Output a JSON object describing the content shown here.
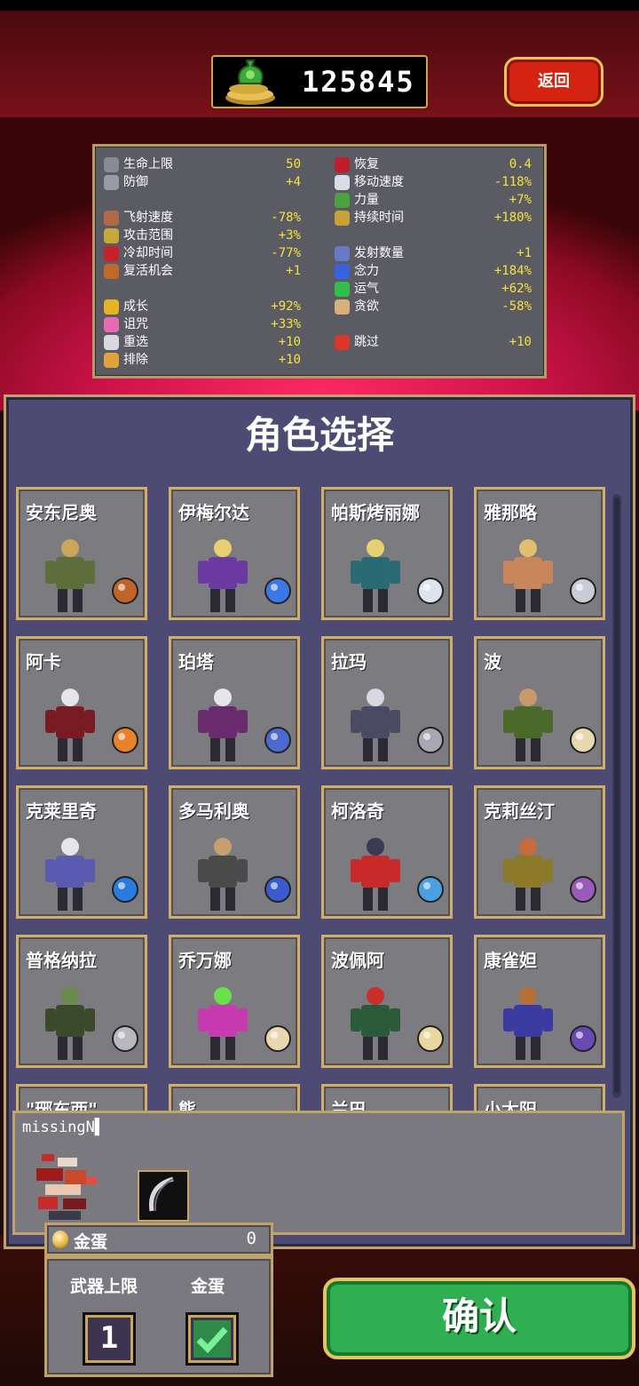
{
  "header": {
    "coins": "125845",
    "back_label": "返回"
  },
  "stats": {
    "left": [
      {
        "name": "生命上限",
        "value": "50",
        "icon": "heart-max-icon",
        "color": "#8a8a92"
      },
      {
        "name": "防御",
        "value": "+4",
        "icon": "armor-icon",
        "color": "#9a9aa6"
      },
      {
        "name": "飞射速度",
        "value": "-78%",
        "icon": "speed-arrow-icon",
        "color": "#b06a48"
      },
      {
        "name": "攻击范围",
        "value": "+3%",
        "icon": "area-icon",
        "color": "#c6a838"
      },
      {
        "name": "冷却时间",
        "value": "-77%",
        "icon": "cooldown-icon",
        "color": "#c8202a"
      },
      {
        "name": "复活机会",
        "value": "+1",
        "icon": "revival-icon",
        "color": "#c06a2a"
      },
      {
        "name": "成长",
        "value": "+92%",
        "icon": "growth-icon",
        "color": "#e6b422"
      },
      {
        "name": "诅咒",
        "value": "+33%",
        "icon": "curse-icon",
        "color": "#e86ab4"
      },
      {
        "name": "重选",
        "value": "+10",
        "icon": "reroll-icon",
        "color": "#d8d8e0"
      },
      {
        "name": "排除",
        "value": "+10",
        "icon": "banish-icon",
        "color": "#e0a23a"
      }
    ],
    "right": [
      {
        "name": "恢复",
        "value": "0.4",
        "icon": "recovery-icon",
        "color": "#c21d2a"
      },
      {
        "name": "移动速度",
        "value": "-118%",
        "icon": "wing-icon",
        "color": "#dadde6"
      },
      {
        "name": "力量",
        "value": "+7%",
        "icon": "might-icon",
        "color": "#4ca040"
      },
      {
        "name": "持续时间",
        "value": "+180%",
        "icon": "duration-icon",
        "color": "#c8a038"
      },
      {
        "name": "发射数量",
        "value": "+1",
        "icon": "amount-icon",
        "color": "#6a78c8"
      },
      {
        "name": "念力",
        "value": "+184%",
        "icon": "magnet-icon",
        "color": "#3a62e0"
      },
      {
        "name": "运气",
        "value": "+62%",
        "icon": "clover-icon",
        "color": "#2ec04a"
      },
      {
        "name": "贪欲",
        "value": "-58%",
        "icon": "greed-icon",
        "color": "#d8b07a"
      },
      {
        "name": "跳过",
        "value": "+10",
        "icon": "skip-icon",
        "color": "#d8382a"
      }
    ]
  },
  "panel": {
    "title": "角色选择",
    "characters": [
      {
        "name": "安东尼奥",
        "body": "#5e6e3a",
        "accent": "#c9a65a",
        "weapon": "#c0642a"
      },
      {
        "name": "伊梅尔达",
        "body": "#6a3aa0",
        "accent": "#e8d070",
        "weapon": "#3a78e8"
      },
      {
        "name": "帕斯烤丽娜",
        "body": "#2a6a72",
        "accent": "#e8d070",
        "weapon": "#dde4ee"
      },
      {
        "name": "雅那略",
        "body": "#c8865a",
        "accent": "#e0c070",
        "weapon": "#c8ccd6"
      },
      {
        "name": "阿卡",
        "body": "#7a1a22",
        "accent": "#e6e6ea",
        "weapon": "#e8822a"
      },
      {
        "name": "珀塔",
        "body": "#6a2a6e",
        "accent": "#e6e6ea",
        "weapon": "#4a6ad0"
      },
      {
        "name": "拉玛",
        "body": "#4a4a62",
        "accent": "#d8d8e0",
        "weapon": "#a8a8b4"
      },
      {
        "name": "波",
        "body": "#4a6a2a",
        "accent": "#c89a6a",
        "weapon": "#e8d8b0"
      },
      {
        "name": "克莱里奇",
        "body": "#5a5ab0",
        "accent": "#e6e6ea",
        "weapon": "#2a7ae0"
      },
      {
        "name": "多马利奥",
        "body": "#4a4a4a",
        "accent": "#c8a070",
        "weapon": "#3a5ad0"
      },
      {
        "name": "柯洛奇",
        "body": "#c82a2a",
        "accent": "#3a3a52",
        "weapon": "#4aa0e0"
      },
      {
        "name": "克莉丝汀",
        "body": "#8a7a2a",
        "accent": "#c86a3a",
        "weapon": "#9a5ab8"
      },
      {
        "name": "普格纳拉",
        "body": "#3a4a2a",
        "accent": "#6a8a4a",
        "weapon": "#b8b8c0"
      },
      {
        "name": "乔万娜",
        "body": "#c83ab0",
        "accent": "#6ae04a",
        "weapon": "#e8d8b0"
      },
      {
        "name": "波佩阿",
        "body": "#2a5a3a",
        "accent": "#c8302a",
        "weapon": "#e8d8a0"
      },
      {
        "name": "康雀妲",
        "body": "#3a3aa0",
        "accent": "#b8703a",
        "weapon": "#6a4ab0"
      },
      {
        "name": "\"琊东西\"",
        "body": "#6a6a6a",
        "accent": "#aaaaaa",
        "weapon": "#888888"
      },
      {
        "name": "熊",
        "body": "#6a6a6a",
        "accent": "#aaaaaa",
        "weapon": "#888888"
      },
      {
        "name": "兰巴",
        "body": "#6a6a6a",
        "accent": "#aaaaaa",
        "weapon": "#888888"
      },
      {
        "name": "小太阳",
        "body": "#6a6a6a",
        "accent": "#aaaaaa",
        "weapon": "#888888"
      }
    ]
  },
  "selected": {
    "name": "missingN▌"
  },
  "eggs": {
    "label": "金蛋",
    "count": "0"
  },
  "options": {
    "weapon_limit_label": "武器上限",
    "weapon_limit_value": "1",
    "golden_egg_label": "金蛋"
  },
  "confirm_label": "确认"
}
